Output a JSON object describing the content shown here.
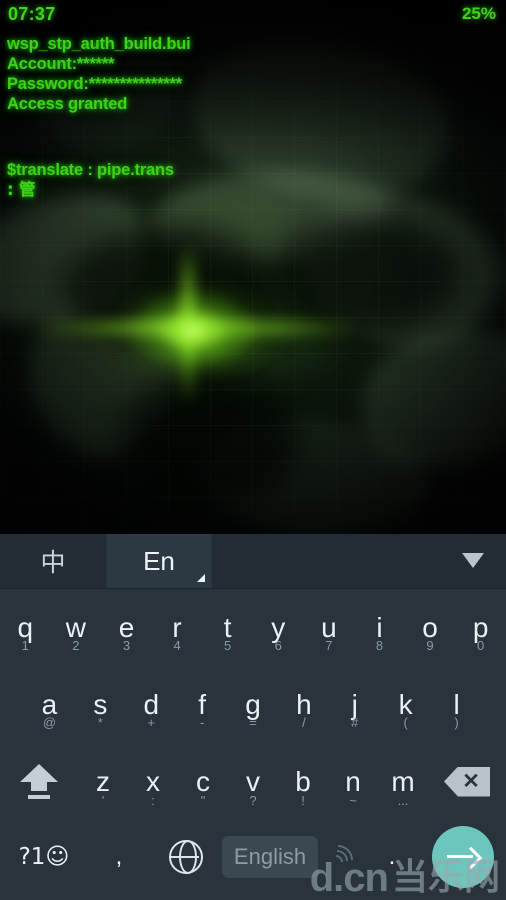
{
  "status_bar": {
    "clock": "07:37",
    "battery": "25%"
  },
  "console": {
    "lines": [
      "wsp_stp_auth_build.bui",
      "Account:******",
      "Password:***************",
      "Access granted"
    ],
    "translate_line": "$translate : pipe.trans",
    "translate_result": ": 管",
    "text_color": "#3ad317"
  },
  "keyboard": {
    "toolbar": {
      "tab_chinese": "中",
      "tab_english": "En",
      "collapse_icon": "chevron-down-icon"
    },
    "row1": [
      {
        "main": "q",
        "sub": "1"
      },
      {
        "main": "w",
        "sub": "2"
      },
      {
        "main": "e",
        "sub": "3"
      },
      {
        "main": "r",
        "sub": "4"
      },
      {
        "main": "t",
        "sub": "5"
      },
      {
        "main": "y",
        "sub": "6"
      },
      {
        "main": "u",
        "sub": "7"
      },
      {
        "main": "i",
        "sub": "8"
      },
      {
        "main": "o",
        "sub": "9"
      },
      {
        "main": "p",
        "sub": "0"
      }
    ],
    "row2": [
      {
        "main": "a",
        "sub": "@"
      },
      {
        "main": "s",
        "sub": "*"
      },
      {
        "main": "d",
        "sub": "+"
      },
      {
        "main": "f",
        "sub": "-"
      },
      {
        "main": "g",
        "sub": "="
      },
      {
        "main": "h",
        "sub": "/"
      },
      {
        "main": "j",
        "sub": "#"
      },
      {
        "main": "k",
        "sub": "("
      },
      {
        "main": "l",
        "sub": ")"
      }
    ],
    "row3": [
      {
        "main": "z",
        "sub": "'"
      },
      {
        "main": "x",
        "sub": ":"
      },
      {
        "main": "c",
        "sub": "\""
      },
      {
        "main": "v",
        "sub": "?"
      },
      {
        "main": "b",
        "sub": "!"
      },
      {
        "main": "n",
        "sub": "~"
      },
      {
        "main": "m",
        "sub": "..."
      }
    ],
    "shift_icon": "shift-arrow-icon",
    "backspace_icon": "backspace-icon",
    "row4": {
      "symbols_label": "?1☺",
      "comma_label": ",",
      "globe_icon": "globe-icon",
      "space_label": "English",
      "voice_icon": "voice-input-icon",
      "period_label": ".",
      "enter_icon": "arrow-right-icon"
    },
    "colors": {
      "keyboard_bg": "#28333b",
      "key_text": "#eaf0f4",
      "sub_text": "#8c9aa4",
      "enter_accent": "#6dc6bd",
      "spacebar_bg": "#3b4751"
    }
  },
  "watermark": {
    "latin": "d.cn",
    "cjk": "当乐网"
  }
}
